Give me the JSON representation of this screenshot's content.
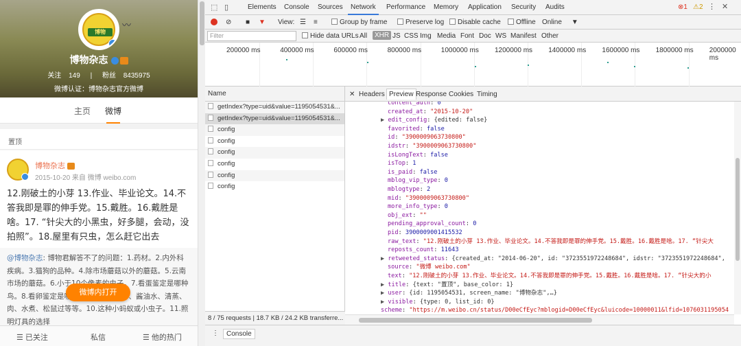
{
  "profile": {
    "avatar_text": "博物",
    "name": "博物杂志",
    "following_label": "关注",
    "following_count": "149",
    "followers_label": "粉丝",
    "followers_count": "8435975",
    "verification": "微博认证：博物杂志官方微博"
  },
  "tabs": {
    "home": "主页",
    "weibo": "微博"
  },
  "pinned_label": "置顶",
  "post": {
    "author": "博物杂志",
    "meta": "2015-10-20 来自 微博 weibo.com",
    "text": "12.刚破土的小芽 13.作业、毕业论文。14.不答我即是罪的伸手党。15.戴胜。16.戴胜是啥。17. “针尖大的小黑虫，好多腿，会动，没拍照”。18.屋里有只虫，怎么赶它出去",
    "repost_mention": "@博物杂志",
    "repost_text": ": 博物君解答不了的问题：1.药材。2.内外科疾病。3.猫狗的品种。4.除市场蘑菇以外的蘑菇。5.云南市场的蘑菇。6.小于10个像素的虫子。7.看蛋鉴定是哪种鸟。8.看卵鉴定是哪种虫咬的。9.干炸、酱油水、清蒸、肉、水煮、松鼠过等等。10.这种小蚂蚁或小虫子。11.照明灯具的选择"
  },
  "open_app_button": "微博内打开",
  "bottom_bar": {
    "follow": "已关注",
    "message": "私信",
    "hot": "他的热门"
  },
  "devtools": {
    "tabs": [
      "Elements",
      "Console",
      "Sources",
      "Network",
      "Performance",
      "Memory",
      "Application",
      "Security",
      "Audits"
    ],
    "active_tab": "Network",
    "error_count": "1",
    "warning_count": "2",
    "view_label": "View:",
    "group_by_frame": "Group by frame",
    "preserve_log": "Preserve log",
    "disable_cache": "Disable cache",
    "offline": "Offline",
    "throttle": "Online",
    "filter_placeholder": "Filter",
    "hide_data_urls": "Hide data URLs",
    "filter_types": [
      "All",
      "XHR",
      "JS",
      "CSS",
      "Img",
      "Media",
      "Font",
      "Doc",
      "WS",
      "Manifest",
      "Other"
    ],
    "timeline_ticks": [
      "200000 ms",
      "400000 ms",
      "600000 ms",
      "800000 ms",
      "1000000 ms",
      "1200000 ms",
      "1400000 ms",
      "1600000 ms",
      "1800000 ms",
      "2000000 ms"
    ],
    "name_header": "Name",
    "requests": [
      "getIndex?type=uid&value=1195054531&...",
      "getIndex?type=uid&value=1195054531&...",
      "config",
      "config",
      "config",
      "config",
      "config",
      "config"
    ],
    "status": "8 / 75 requests  |  18.7 KB / 24.2 KB transferre...",
    "preview_tabs": [
      "Headers",
      "Preview",
      "Response",
      "Cookies",
      "Timing"
    ],
    "console_tab": "Console",
    "preview_lines": [
      {
        "t": "kv",
        "k": "content_auth",
        "v": "0",
        "vt": "n"
      },
      {
        "t": "kv",
        "k": "created_at",
        "v": "\"2015-10-20\"",
        "vt": "s"
      },
      {
        "t": "obj",
        "k": "edit_config",
        "v": "{edited: false}"
      },
      {
        "t": "kv",
        "k": "favorited",
        "v": "false",
        "vt": "n"
      },
      {
        "t": "kv",
        "k": "id",
        "v": "\"3900009063730800\"",
        "vt": "s"
      },
      {
        "t": "kv",
        "k": "idstr",
        "v": "\"3900009063730800\"",
        "vt": "s"
      },
      {
        "t": "kv",
        "k": "isLongText",
        "v": "false",
        "vt": "n"
      },
      {
        "t": "kv",
        "k": "isTop",
        "v": "1",
        "vt": "n"
      },
      {
        "t": "kv",
        "k": "is_paid",
        "v": "false",
        "vt": "n"
      },
      {
        "t": "kv",
        "k": "mblog_vip_type",
        "v": "0",
        "vt": "n"
      },
      {
        "t": "kv",
        "k": "mblogtype",
        "v": "2",
        "vt": "n"
      },
      {
        "t": "kv",
        "k": "mid",
        "v": "\"3900009063730800\"",
        "vt": "s"
      },
      {
        "t": "kv",
        "k": "more_info_type",
        "v": "0",
        "vt": "n"
      },
      {
        "t": "kv",
        "k": "obj_ext",
        "v": "\"\"",
        "vt": "s"
      },
      {
        "t": "kv",
        "k": "pending_approval_count",
        "v": "0",
        "vt": "n"
      },
      {
        "t": "kv",
        "k": "pid",
        "v": "3900009001415532",
        "vt": "n"
      },
      {
        "t": "kv",
        "k": "raw_text",
        "v": "\"12.刚破土的小芽 13.作业、毕业论文。14.不答我即是罪的伸手党。15.戴胜。16.戴胜是啥。17. “针尖大",
        "vt": "s"
      },
      {
        "t": "kv",
        "k": "reposts_count",
        "v": "11643",
        "vt": "n"
      },
      {
        "t": "obj",
        "k": "retweeted_status",
        "v": "{created_at: \"2014-06-20\", id: \"3723551972248684\", idstr: \"3723551972248684\","
      },
      {
        "t": "kv",
        "k": "source",
        "v": "\"微博 weibo.com\"",
        "vt": "s"
      },
      {
        "t": "kv",
        "k": "text",
        "v": "\"12.刚破土的小芽 13.作业、毕业论文。14.不答我即是罪的伸手党。15.戴胜。16.戴胜是啥。17. “针尖大的小",
        "vt": "s"
      },
      {
        "t": "obj",
        "k": "title",
        "v": "{text: \"置顶\", base_color: 1}"
      },
      {
        "t": "obj",
        "k": "user",
        "v": "{id: 1195054531, screen_name: \"博物杂志\",…}"
      },
      {
        "t": "obj",
        "k": "visible",
        "v": "{type: 0, list_id: 0}"
      },
      {
        "t": "kv0",
        "k": "scheme",
        "v": "\"https://m.weibo.cn/status/D00eCfEyc?mblogid=D00eCfEyc&luicode=10000011&lfid=1076031195054",
        "vt": "s"
      }
    ]
  }
}
